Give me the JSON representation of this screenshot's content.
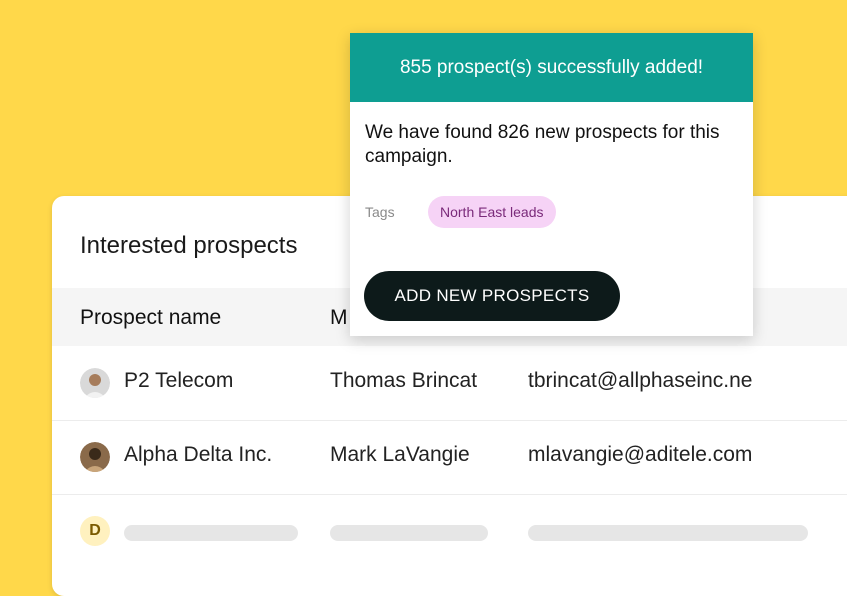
{
  "card": {
    "title": "Interested prospects",
    "columns": [
      "Prospect name",
      "M"
    ],
    "rows": [
      {
        "company": "P2 Telecom",
        "contact": "Thomas Brincat",
        "email": "tbrincat@allphaseinc.ne"
      },
      {
        "company": "Alpha Delta Inc.",
        "contact": "Mark LaVangie",
        "email": "mlavangie@aditele.com"
      }
    ],
    "placeholder_row": {
      "avatar_letter": "D"
    }
  },
  "popup": {
    "banner": "855 prospect(s) successfully added!",
    "message": "We have found 826 new prospects for this campaign.",
    "tags_label": "Tags",
    "tag": "North East leads",
    "button": "ADD NEW PROSPECTS"
  },
  "colors": {
    "background": "#FFD84A",
    "banner": "#0E9E92",
    "button": "#0D1A1A",
    "tag_bg": "#F6D3F6"
  }
}
